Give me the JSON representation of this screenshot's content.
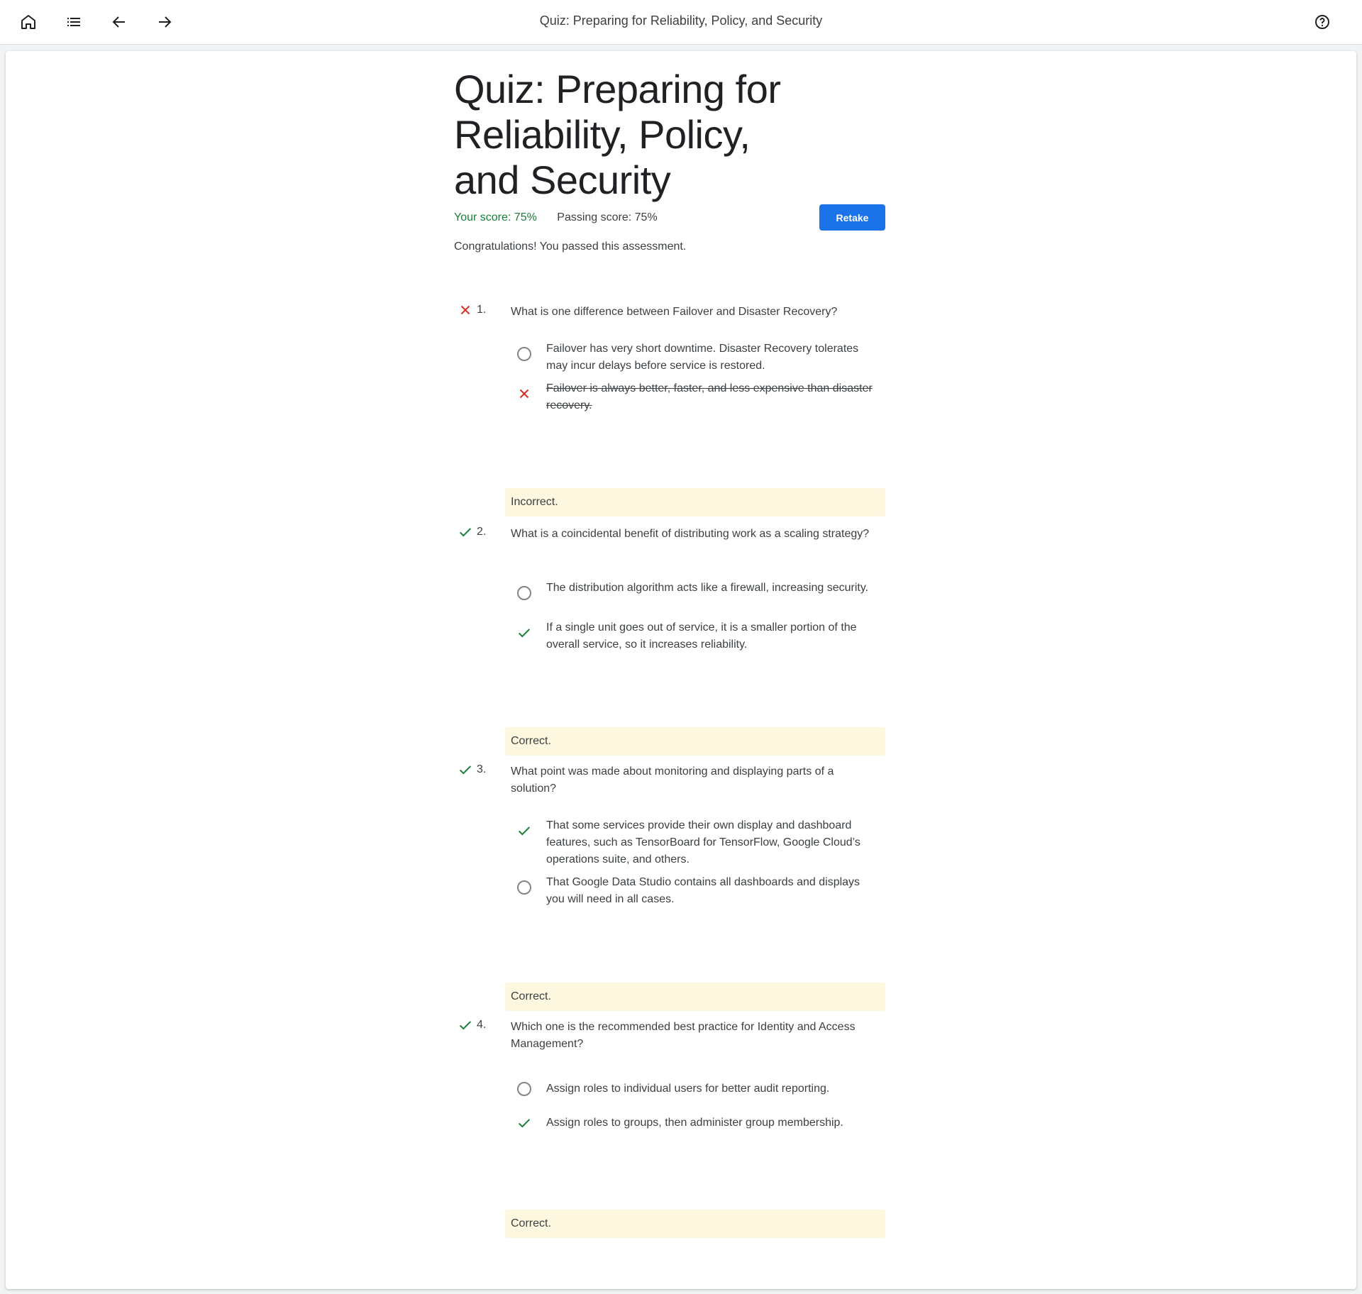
{
  "topbar": {
    "title": "Quiz: Preparing for Reliability, Policy, and Security",
    "icons": [
      "home-icon",
      "list-icon",
      "arrow-back-icon",
      "arrow-forward-icon",
      "help-icon"
    ]
  },
  "quiz": {
    "title": "Quiz: Preparing for Reliability, Policy, and Security",
    "your_score": "Your score: 75%",
    "passing_score": "Passing score: 75%",
    "retake_label": "Retake",
    "message": "Congratulations! You passed this assessment."
  },
  "colors": {
    "correct": "#188038",
    "incorrect": "#d93025",
    "primary": "#1a73e8",
    "feedback_bg": "#fef7e0"
  },
  "questions": [
    {
      "number": "1.",
      "status": "incorrect",
      "text": "What is one difference between Failover and Disaster Recovery?",
      "options": [
        {
          "text": "Failover has very short downtime. Disaster Recovery tolerates may incur delays before service is restored.",
          "state": "unselected"
        },
        {
          "text": "Failover is always better, faster, and less expensive than disaster recovery.",
          "state": "selected-incorrect"
        }
      ],
      "feedback": "Incorrect."
    },
    {
      "number": "2.",
      "status": "correct",
      "text": "What is a coincidental benefit of distributing work as a scaling strategy?",
      "options": [
        {
          "text": "The distribution algorithm acts like a firewall, increasing security.",
          "state": "unselected"
        },
        {
          "text": "If a single unit goes out of service, it is a smaller portion of the overall service, so it increases reliability.",
          "state": "selected-correct"
        }
      ],
      "feedback": "Correct."
    },
    {
      "number": "3.",
      "status": "correct",
      "text": "What point was made about monitoring and displaying parts of a solution?",
      "options": [
        {
          "text": "That some services provide their own display and dashboard features, such as TensorBoard for TensorFlow, Google Cloud’s operations suite, and others.",
          "state": "selected-correct"
        },
        {
          "text": "That Google Data Studio contains all dashboards and displays you will need in all cases.",
          "state": "unselected"
        }
      ],
      "feedback": "Correct."
    },
    {
      "number": "4.",
      "status": "correct",
      "text": "Which one is the recommended best practice for Identity and Access Management?",
      "options": [
        {
          "text": "Assign roles to individual users for better audit reporting.",
          "state": "unselected"
        },
        {
          "text": "Assign roles to groups, then administer group membership.",
          "state": "selected-correct"
        }
      ],
      "feedback": "Correct."
    }
  ]
}
